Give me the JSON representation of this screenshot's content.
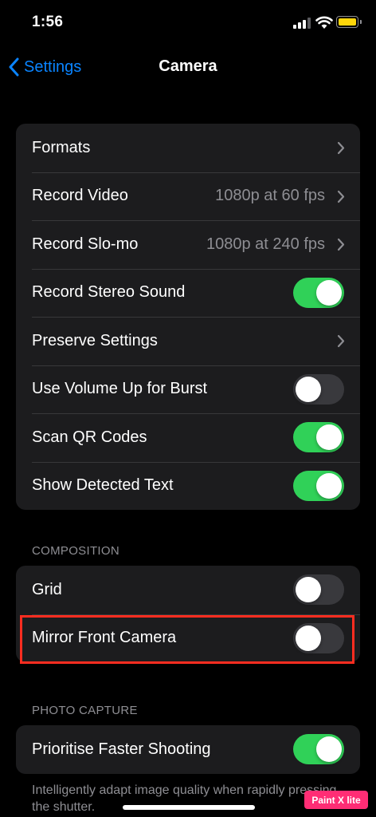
{
  "status_bar": {
    "time": "1:56"
  },
  "nav": {
    "back_label": "Settings",
    "title": "Camera"
  },
  "group1": [
    {
      "label": "Formats",
      "value": "",
      "control": "chevron"
    },
    {
      "label": "Record Video",
      "value": "1080p at 60 fps",
      "control": "chevron"
    },
    {
      "label": "Record Slo-mo",
      "value": "1080p at 240 fps",
      "control": "chevron"
    },
    {
      "label": "Record Stereo Sound",
      "control": "toggle",
      "on": true
    },
    {
      "label": "Preserve Settings",
      "value": "",
      "control": "chevron"
    },
    {
      "label": "Use Volume Up for Burst",
      "control": "toggle",
      "on": false
    },
    {
      "label": "Scan QR Codes",
      "control": "toggle",
      "on": true
    },
    {
      "label": "Show Detected Text",
      "control": "toggle",
      "on": true
    }
  ],
  "composition": {
    "header": "COMPOSITION",
    "rows": [
      {
        "label": "Grid",
        "control": "toggle",
        "on": false
      },
      {
        "label": "Mirror Front Camera",
        "control": "toggle",
        "on": false
      }
    ]
  },
  "photo_capture": {
    "header": "PHOTO CAPTURE",
    "rows": [
      {
        "label": "Prioritise Faster Shooting",
        "control": "toggle",
        "on": true
      }
    ],
    "footer": "Intelligently adapt image quality when rapidly pressing the shutter."
  },
  "watermark": "Paint X lite",
  "colors": {
    "accent": "#0a84ff",
    "toggle_on": "#30d158",
    "toggle_off": "#39393d",
    "highlight": "#ff2d20",
    "battery": "#ffd60a",
    "watermark": "#ff2d75"
  },
  "icons": [
    "signal-icon",
    "wifi-icon",
    "battery-icon",
    "back-chevron-icon",
    "chevron-right-icon"
  ]
}
